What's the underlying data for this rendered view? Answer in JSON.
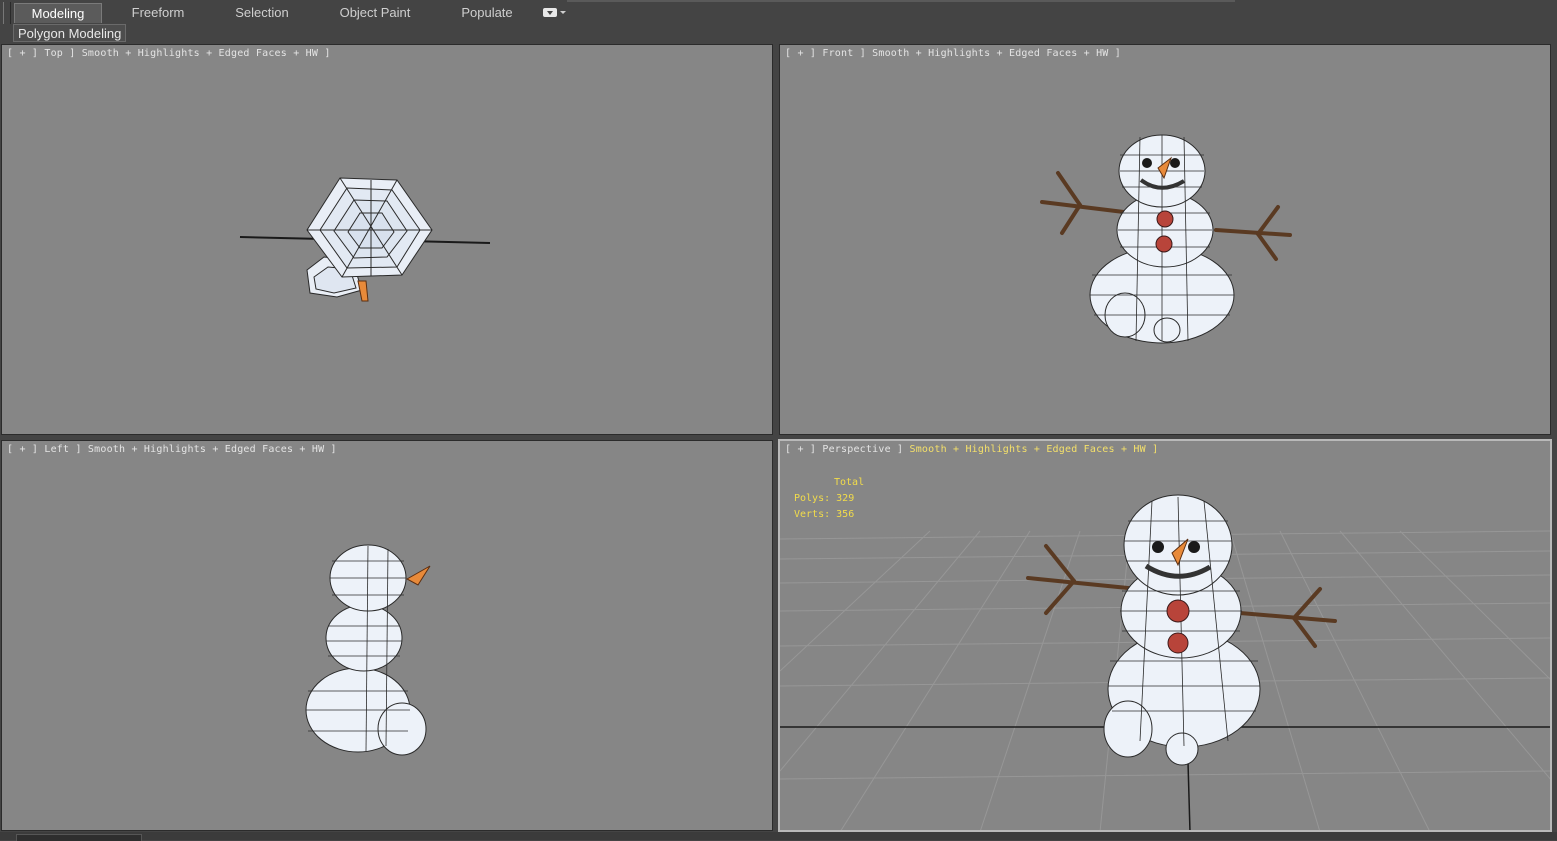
{
  "ribbon": {
    "tabs": [
      {
        "label": "Modeling",
        "active": true
      },
      {
        "label": "Freeform",
        "active": false
      },
      {
        "label": "Selection",
        "active": false
      },
      {
        "label": "Object Paint",
        "active": false
      },
      {
        "label": "Populate",
        "active": false
      }
    ],
    "options_icon": "dropdown-options-icon"
  },
  "panel": {
    "label": "Polygon Modeling"
  },
  "viewports": {
    "top": {
      "plus": "+",
      "view": "Top",
      "shading": "Smooth + Highlights + Edged Faces + HW"
    },
    "front": {
      "plus": "+",
      "view": "Front",
      "shading": "Smooth + Highlights + Edged Faces + HW"
    },
    "left": {
      "plus": "+",
      "view": "Left",
      "shading": "Smooth + Highlights + Edged Faces + HW"
    },
    "perspective": {
      "plus": "+",
      "view": "Perspective",
      "shading": "Smooth + Highlights + Edged Faces + HW",
      "stats": {
        "total_label": "Total",
        "polys_label": "Polys:",
        "polys": "329",
        "verts_label": "Verts:",
        "verts": "356"
      }
    }
  },
  "colors": {
    "viewport_bg": "#868686",
    "ui_bg": "#444444",
    "label_highlight": "#f4e06a",
    "stats_text": "#f2dc4a",
    "snow": "#eef3fa",
    "stick": "#8b5a3c",
    "carrot": "#e88a3a",
    "button": "#b8443a"
  }
}
